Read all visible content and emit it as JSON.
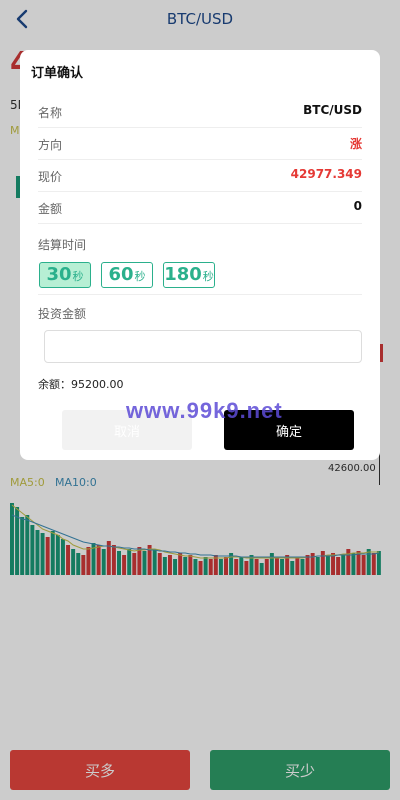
{
  "header": {
    "title": "BTC/USD"
  },
  "background": {
    "price_fragment": "4",
    "tab_label": "5M",
    "ma_label": "M",
    "axis_label": "42600.00",
    "vol_ma5": "MA5:0",
    "vol_ma10": "MA10:0"
  },
  "modal": {
    "title": "订单确认",
    "rows": [
      {
        "label": "名称",
        "value": "BTC/USD"
      },
      {
        "label": "方向",
        "value": "涨"
      },
      {
        "label": "现价",
        "value": "42977.349"
      },
      {
        "label": "金额",
        "value": "0"
      }
    ],
    "settle_label": "结算时间",
    "times": [
      {
        "num": "30",
        "unit": "秒",
        "active": true
      },
      {
        "num": "60",
        "unit": "秒",
        "active": false
      },
      {
        "num": "180",
        "unit": "秒",
        "active": false
      }
    ],
    "invest_label": "投资金额",
    "amount_placeholder": "",
    "balance": "余额：95200.00",
    "cancel": "取消",
    "confirm": "确定"
  },
  "watermark": "www.99k9.net",
  "footer": {
    "buy_more": "买多",
    "buy_less": "买少"
  },
  "colors": {
    "up": "#d23a3a",
    "down": "#1a9a79",
    "accent": "#2bb08c"
  },
  "chart_data": {
    "type": "bar",
    "title": "",
    "xlabel": "",
    "ylabel": "",
    "series": [
      {
        "name": "",
        "values": [
          72,
          68,
          58,
          60,
          50,
          45,
          42,
          38,
          44,
          40,
          36,
          30,
          26,
          22,
          20,
          28,
          32,
          30,
          26,
          34,
          30,
          24,
          20,
          26,
          22,
          28,
          24,
          30,
          26,
          22,
          18,
          20,
          16,
          22,
          18,
          20,
          16,
          14,
          18,
          16,
          20,
          16,
          18,
          22,
          16,
          18,
          14,
          20,
          16,
          12,
          16,
          22,
          18,
          16,
          20,
          14,
          18,
          16,
          20,
          22,
          18,
          24,
          20,
          22,
          18,
          20,
          26,
          22,
          24,
          20,
          26,
          22,
          24
        ],
        "colors": [
          "d",
          "d",
          "d",
          "d",
          "d",
          "d",
          "d",
          "u",
          "d",
          "d",
          "d",
          "u",
          "d",
          "d",
          "u",
          "u",
          "d",
          "u",
          "d",
          "u",
          "u",
          "d",
          "u",
          "d",
          "u",
          "u",
          "d",
          "u",
          "d",
          "u",
          "d",
          "u",
          "d",
          "u",
          "d",
          "u",
          "d",
          "u",
          "d",
          "u",
          "u",
          "d",
          "u",
          "d",
          "u",
          "d",
          "u",
          "d",
          "u",
          "d",
          "u",
          "d",
          "u",
          "d",
          "u",
          "d",
          "u",
          "d",
          "u",
          "u",
          "d",
          "u",
          "d",
          "u",
          "u",
          "d",
          "u",
          "d",
          "u",
          "u",
          "d",
          "u",
          "d"
        ]
      },
      {
        "name": "",
        "values": [
          70,
          66,
          62,
          58,
          54,
          50,
          46,
          44,
          42,
          40,
          36,
          34,
          30,
          28,
          26,
          26,
          27,
          28,
          29,
          29,
          28,
          27,
          26,
          25,
          24,
          25,
          25,
          26,
          26,
          25,
          23,
          22,
          21,
          20,
          19,
          19,
          18,
          17,
          17,
          17,
          17,
          17,
          17,
          18,
          18,
          18,
          17,
          17,
          17,
          17,
          17,
          17,
          17,
          17,
          17,
          17,
          17,
          17,
          18,
          18,
          19,
          19,
          20,
          20,
          20,
          21,
          21,
          22,
          22,
          22,
          23,
          23,
          23
        ]
      },
      {
        "name": "",
        "values": [
          60,
          58,
          56,
          55,
          53,
          51,
          49,
          47,
          45,
          43,
          41,
          39,
          37,
          35,
          33,
          32,
          31,
          30,
          29,
          29,
          28,
          28,
          27,
          27,
          26,
          26,
          26,
          25,
          25,
          24,
          24,
          23,
          23,
          22,
          22,
          21,
          21,
          20,
          20,
          20,
          19,
          19,
          19,
          19,
          19,
          18,
          18,
          18,
          18,
          18,
          18,
          18,
          18,
          18,
          18,
          18,
          18,
          18,
          18,
          18,
          19,
          19,
          19,
          19,
          20,
          20,
          20,
          20,
          21,
          21,
          21,
          21,
          22
        ]
      }
    ]
  }
}
